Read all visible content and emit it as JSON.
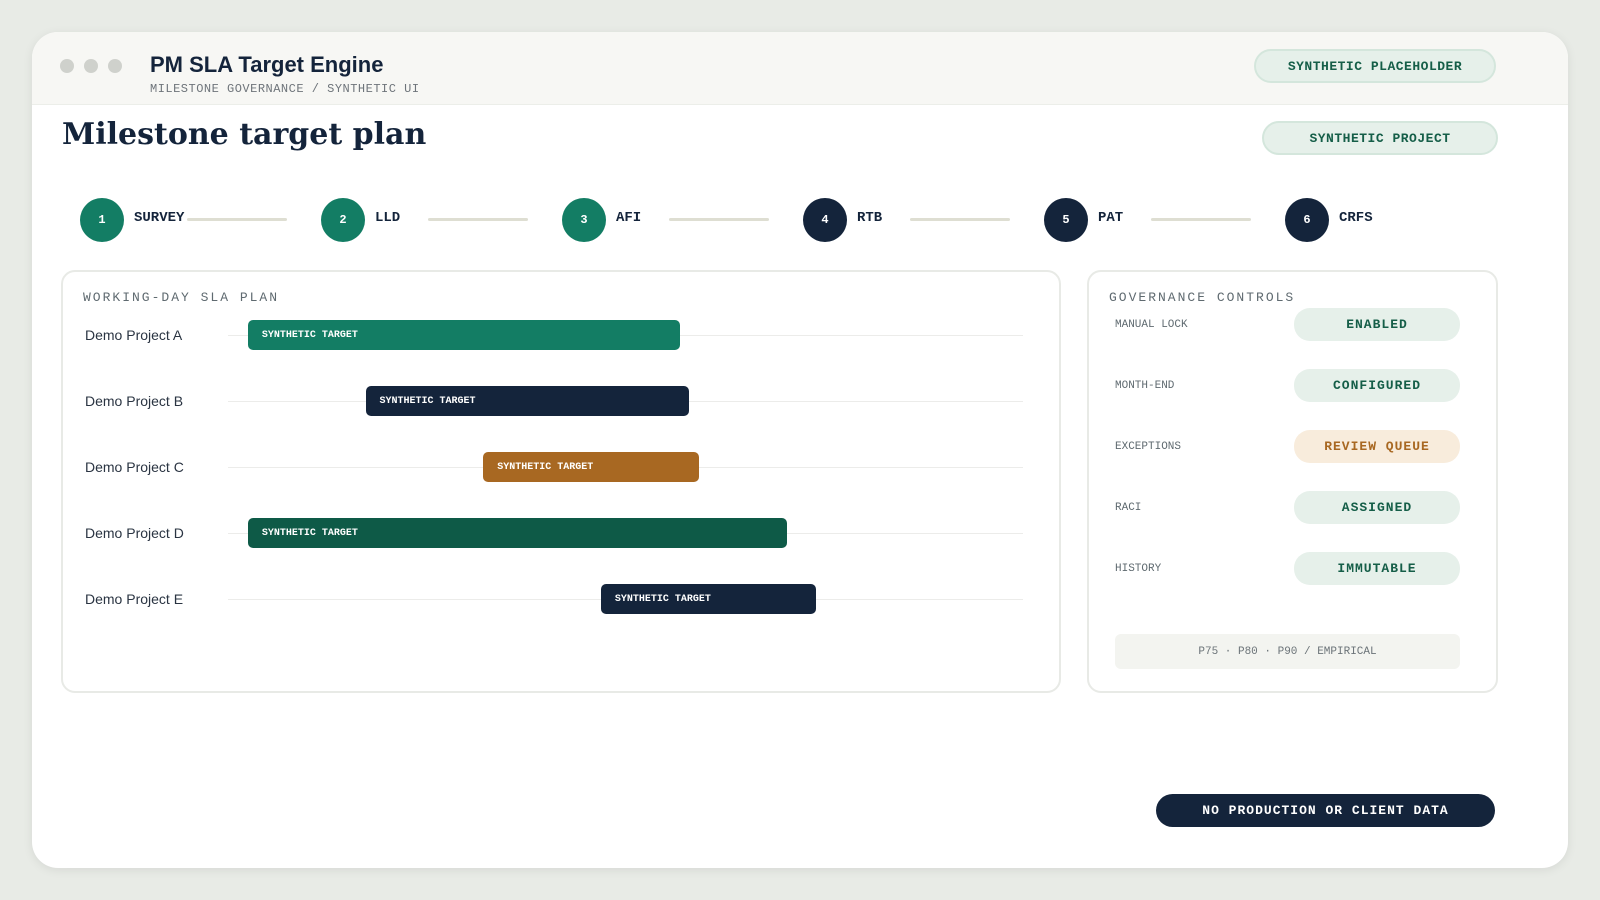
{
  "app": {
    "title": "PM SLA Target Engine",
    "subtitle": "MILESTONE GOVERNANCE / SYNTHETIC UI",
    "header_badge": "SYNTHETIC PLACEHOLDER"
  },
  "page": {
    "title": "Milestone target plan",
    "project_badge": "SYNTHETIC PROJECT"
  },
  "steps": [
    {
      "number": "1",
      "label": "SURVEY",
      "color": "#137d64"
    },
    {
      "number": "2",
      "label": "LLD",
      "color": "#137d64"
    },
    {
      "number": "3",
      "label": "AFI",
      "color": "#137d64"
    },
    {
      "number": "4",
      "label": "RTB",
      "color": "#14243b"
    },
    {
      "number": "5",
      "label": "PAT",
      "color": "#14243b"
    },
    {
      "number": "6",
      "label": "CRFS",
      "color": "#14243b"
    }
  ],
  "sla_plan": {
    "title": "WORKING-DAY SLA PLAN",
    "rows": [
      {
        "project": "Demo Project A",
        "bar_label": "SYNTHETIC TARGET",
        "start": 0.025,
        "end": 0.568,
        "color": "#137d64"
      },
      {
        "project": "Demo Project B",
        "bar_label": "SYNTHETIC TARGET",
        "start": 0.173,
        "end": 0.58,
        "color": "#14243b"
      },
      {
        "project": "Demo Project C",
        "bar_label": "SYNTHETIC TARGET",
        "start": 0.321,
        "end": 0.592,
        "color": "#a86822"
      },
      {
        "project": "Demo Project D",
        "bar_label": "SYNTHETIC TARGET",
        "start": 0.025,
        "end": 0.703,
        "color": "#0e5a47"
      },
      {
        "project": "Demo Project E",
        "bar_label": "SYNTHETIC TARGET",
        "start": 0.469,
        "end": 0.74,
        "color": "#14243b"
      }
    ]
  },
  "governance": {
    "title": "GOVERNANCE CONTROLS",
    "controls": [
      {
        "label": "MANUAL LOCK",
        "value": "ENABLED",
        "bg": "#e6f0ea",
        "fg": "#155e48"
      },
      {
        "label": "MONTH-END",
        "value": "CONFIGURED",
        "bg": "#e6f0ea",
        "fg": "#155e48"
      },
      {
        "label": "EXCEPTIONS",
        "value": "REVIEW QUEUE",
        "bg": "#f8ecdc",
        "fg": "#a86822"
      },
      {
        "label": "RACI",
        "value": "ASSIGNED",
        "bg": "#e6f0ea",
        "fg": "#155e48"
      },
      {
        "label": "HISTORY",
        "value": "IMMUTABLE",
        "bg": "#e6f0ea",
        "fg": "#155e48"
      }
    ],
    "percentiles": "P75 · P80 · P90 / EMPIRICAL"
  },
  "footer": {
    "notice": "NO PRODUCTION OR CLIENT DATA"
  }
}
